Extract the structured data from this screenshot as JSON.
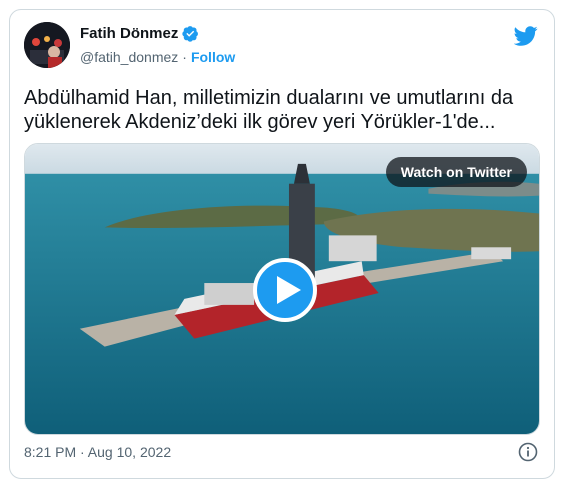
{
  "author": {
    "name": "Fatih Dönmez",
    "handle": "@fatih_donmez",
    "separator": "·",
    "follow_label": "Follow"
  },
  "tweet": {
    "text": "Abdülhamid Han, milletimizin dualarını ve umutlarını da yüklenerek Akdeniz’deki ilk görev yeri Yörükler-1'de..."
  },
  "media": {
    "watch_label": "Watch on Twitter"
  },
  "meta": {
    "timestamp": "8:21 PM · Aug 10, 2022"
  },
  "colors": {
    "accent": "#1d9bf0",
    "text": "#0f1419",
    "secondary": "#536471",
    "border": "#cfd9de"
  },
  "icons": [
    "verified-badge-icon",
    "twitter-bird-icon",
    "play-icon",
    "info-icon"
  ]
}
